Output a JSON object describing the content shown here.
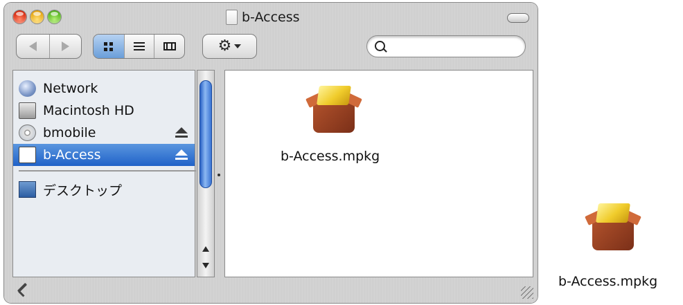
{
  "window": {
    "title": "b-Access"
  },
  "toolbar": {
    "back_icon": "back-arrow-icon",
    "forward_icon": "forward-arrow-icon",
    "views": [
      "icon-view",
      "list-view",
      "column-view"
    ],
    "active_view": "icon-view",
    "action_icon": "gear-icon",
    "search": {
      "value": "",
      "placeholder": ""
    }
  },
  "sidebar": {
    "items": [
      {
        "label": "Network",
        "icon": "network-icon"
      },
      {
        "label": "Macintosh HD",
        "icon": "hard-drive-icon"
      },
      {
        "label": "bmobile",
        "icon": "cd-disc-icon",
        "ejectable": true
      },
      {
        "label": "b-Access",
        "icon": "volume-icon",
        "ejectable": true,
        "selected": true
      },
      {
        "label": "デスクトップ",
        "icon": "desktop-icon"
      }
    ]
  },
  "content": {
    "files": [
      {
        "name": "b-Access.mpkg",
        "icon": "package-icon"
      }
    ]
  },
  "standalone_icon": {
    "name": "b-Access.mpkg",
    "icon": "package-icon"
  },
  "colors": {
    "selection": "#2062c8",
    "scroll_thumb": "#3a74d4"
  }
}
